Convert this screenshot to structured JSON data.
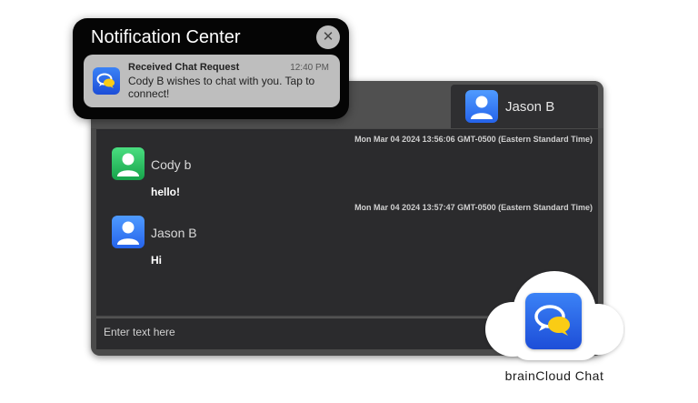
{
  "notification_center": {
    "title": "Notification Center",
    "close_icon": "close-icon",
    "notification": {
      "app_icon": "chat-bubbles-icon",
      "subject": "Received Chat Request",
      "time": "12:40 PM",
      "body": "Cody B wishes to chat with you. Tap to connect!"
    }
  },
  "chat": {
    "active_user": {
      "name": "Jason B",
      "avatar": "user-avatar-icon",
      "color": "#2563eb"
    },
    "messages": [
      {
        "timestamp": "Mon Mar 04 2024 13:56:06 GMT-0500 (Eastern Standard Time)",
        "sender": "Cody b",
        "avatar_color": "#16a34a",
        "text": "hello!"
      },
      {
        "timestamp": "Mon Mar 04 2024 13:57:47 GMT-0500 (Eastern Standard Time)",
        "sender": "Jason B",
        "avatar_color": "#2563eb",
        "text": "Hi"
      }
    ],
    "input": {
      "placeholder": "Enter text here"
    }
  },
  "brand": {
    "app_icon": "chat-bubbles-icon",
    "label": "brainCloud Chat"
  }
}
